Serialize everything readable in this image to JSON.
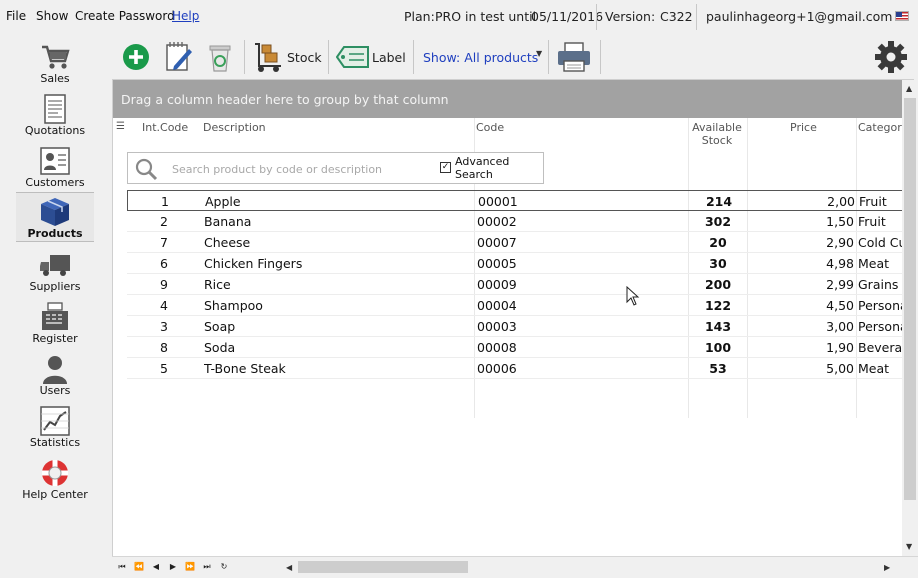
{
  "menu": {
    "file": "File",
    "show": "Show",
    "create_password": "Create Password",
    "help": "Help"
  },
  "status": {
    "plan_label": "Plan:",
    "plan_value": "PRO in test until",
    "plan_date": "05/11/2016",
    "version_label": "Version:",
    "version_value": "C322",
    "account": "paulinhageorg+1@gmail.com"
  },
  "sidebar": {
    "items": [
      {
        "label": "Sales",
        "icon": "cart-icon"
      },
      {
        "label": "Quotations",
        "icon": "document-icon"
      },
      {
        "label": "Customers",
        "icon": "contact-card-icon"
      },
      {
        "label": "Products",
        "icon": "box-icon"
      },
      {
        "label": "Suppliers",
        "icon": "truck-icon"
      },
      {
        "label": "Register",
        "icon": "cash-register-icon"
      },
      {
        "label": "Users",
        "icon": "user-icon"
      },
      {
        "label": "Statistics",
        "icon": "chart-icon"
      },
      {
        "label": "Help Center",
        "icon": "lifebuoy-icon"
      }
    ],
    "active": "Products"
  },
  "toolbar": {
    "stock_label": "Stock",
    "label_label": "Label",
    "show_filter": "Show: All products"
  },
  "grid": {
    "group_hint": "Drag a column header here to group by that column",
    "columns": {
      "int_code": "Int.Code",
      "description": "Description",
      "code": "Code",
      "stock_line1": "Available",
      "stock_line2": "Stock",
      "price": "Price",
      "category": "Categori"
    },
    "search": {
      "placeholder": "Search product by code or description",
      "advanced_line1": "Advanced",
      "advanced_line2": "Search",
      "advanced_checked": true
    },
    "rows": [
      {
        "int": "1",
        "desc": "Apple",
        "code": "00001",
        "stock": "214",
        "price": "2,00",
        "cat": "Fruit"
      },
      {
        "int": "2",
        "desc": "Banana",
        "code": "00002",
        "stock": "302",
        "price": "1,50",
        "cat": "Fruit"
      },
      {
        "int": "7",
        "desc": "Cheese",
        "code": "00007",
        "stock": "20",
        "price": "2,90",
        "cat": "Cold Cu"
      },
      {
        "int": "6",
        "desc": "Chicken Fingers",
        "code": "00005",
        "stock": "30",
        "price": "4,98",
        "cat": "Meat"
      },
      {
        "int": "9",
        "desc": "Rice",
        "code": "00009",
        "stock": "200",
        "price": "2,99",
        "cat": "Grains"
      },
      {
        "int": "4",
        "desc": "Shampoo",
        "code": "00004",
        "stock": "122",
        "price": "4,50",
        "cat": "Persona"
      },
      {
        "int": "3",
        "desc": "Soap",
        "code": "00003",
        "stock": "143",
        "price": "3,00",
        "cat": "Persona"
      },
      {
        "int": "8",
        "desc": "Soda",
        "code": "00008",
        "stock": "100",
        "price": "1,90",
        "cat": "Bevera"
      },
      {
        "int": "5",
        "desc": "T-Bone Steak",
        "code": "00006",
        "stock": "53",
        "price": "5,00",
        "cat": "Meat"
      }
    ],
    "selected_row": 0
  },
  "colors": {
    "accent_link": "#1f3fbf",
    "group_bar": "#a2a2a2",
    "add_green": "#1a9a4a"
  }
}
